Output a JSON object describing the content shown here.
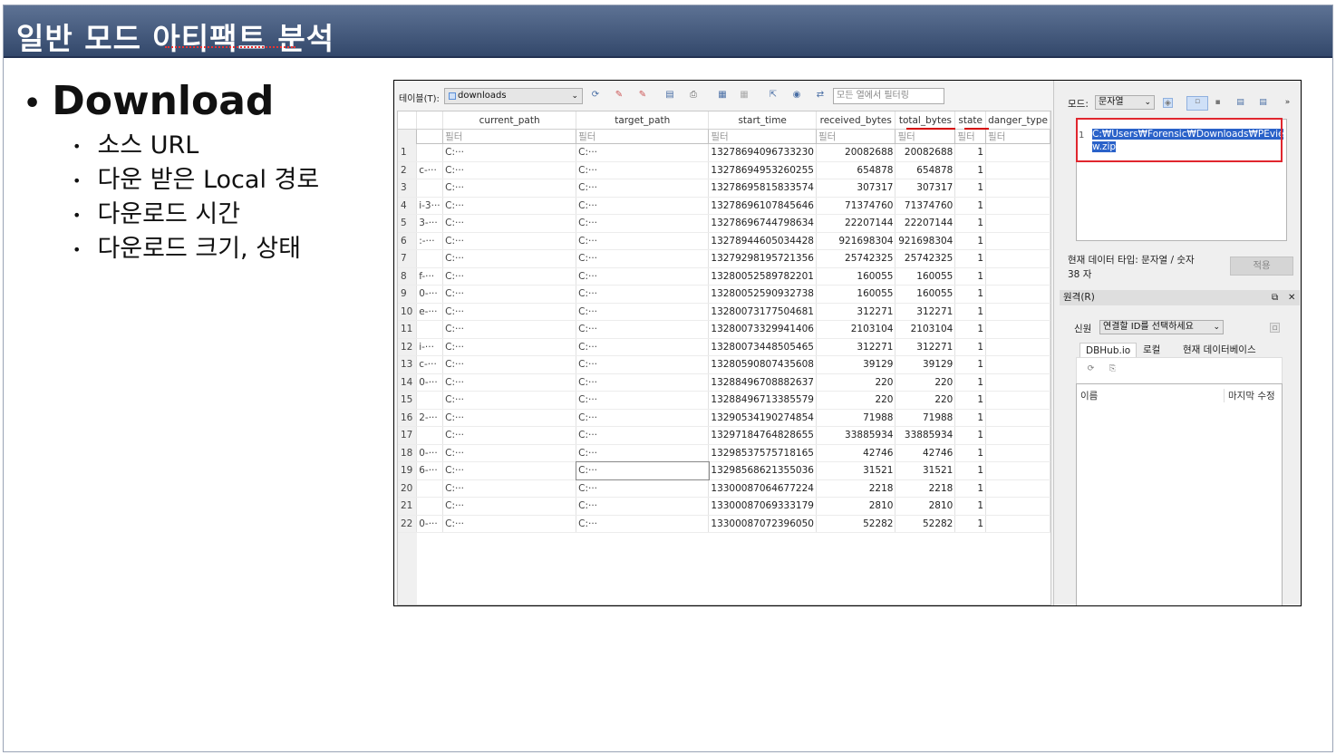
{
  "slide": {
    "title": "일반 모드 아티팩트 분석",
    "main_bullet": "Download",
    "sub_bullets": [
      "소스 URL",
      "다운 받은 Local 경로",
      "다운로드 시간",
      "다운로드 크기, 상태"
    ]
  },
  "toolbar": {
    "table_label": "테이블(T):",
    "table_value": "downloads",
    "filter_placeholder": "모든 열에서 필터링"
  },
  "grid": {
    "columns": [
      "current_path",
      "target_path",
      "start_time",
      "received_bytes",
      "total_bytes",
      "state",
      "danger_type"
    ],
    "filter_text": "필터",
    "rows": [
      {
        "n": "1",
        "pre": "",
        "cp": "C:···",
        "tp": "C:···",
        "st": "13278694096733230",
        "rb": "20082688",
        "tb": "20082688",
        "s": "1"
      },
      {
        "n": "2",
        "pre": "c-···",
        "cp": "C:···",
        "tp": "C:···",
        "st": "13278694953260255",
        "rb": "654878",
        "tb": "654878",
        "s": "1"
      },
      {
        "n": "3",
        "pre": "",
        "cp": "C:···",
        "tp": "C:···",
        "st": "13278695815833574",
        "rb": "307317",
        "tb": "307317",
        "s": "1"
      },
      {
        "n": "4",
        "pre": "i-3···",
        "cp": "C:···",
        "tp": "C:···",
        "st": "13278696107845646",
        "rb": "71374760",
        "tb": "71374760",
        "s": "1"
      },
      {
        "n": "5",
        "pre": "3-···",
        "cp": "C:···",
        "tp": "C:···",
        "st": "13278696744798634",
        "rb": "22207144",
        "tb": "22207144",
        "s": "1"
      },
      {
        "n": "6",
        "pre": ":-···",
        "cp": "C:···",
        "tp": "C:···",
        "st": "13278944605034428",
        "rb": "921698304",
        "tb": "921698304",
        "s": "1"
      },
      {
        "n": "7",
        "pre": "",
        "cp": "C:···",
        "tp": "C:···",
        "st": "13279298195721356",
        "rb": "25742325",
        "tb": "25742325",
        "s": "1"
      },
      {
        "n": "8",
        "pre": "f-···",
        "cp": "C:···",
        "tp": "C:···",
        "st": "13280052589782201",
        "rb": "160055",
        "tb": "160055",
        "s": "1"
      },
      {
        "n": "9",
        "pre": "0-···",
        "cp": "C:···",
        "tp": "C:···",
        "st": "13280052590932738",
        "rb": "160055",
        "tb": "160055",
        "s": "1"
      },
      {
        "n": "10",
        "pre": "e-···",
        "cp": "C:···",
        "tp": "C:···",
        "st": "13280073177504681",
        "rb": "312271",
        "tb": "312271",
        "s": "1"
      },
      {
        "n": "11",
        "pre": "",
        "cp": "C:···",
        "tp": "C:···",
        "st": "13280073329941406",
        "rb": "2103104",
        "tb": "2103104",
        "s": "1"
      },
      {
        "n": "12",
        "pre": "i-···",
        "cp": "C:···",
        "tp": "C:···",
        "st": "13280073448505465",
        "rb": "312271",
        "tb": "312271",
        "s": "1"
      },
      {
        "n": "13",
        "pre": "c-···",
        "cp": "C:···",
        "tp": "C:···",
        "st": "13280590807435608",
        "rb": "39129",
        "tb": "39129",
        "s": "1"
      },
      {
        "n": "14",
        "pre": "0-···",
        "cp": "C:···",
        "tp": "C:···",
        "st": "13288496708882637",
        "rb": "220",
        "tb": "220",
        "s": "1"
      },
      {
        "n": "15",
        "pre": "",
        "cp": "C:···",
        "tp": "C:···",
        "st": "13288496713385579",
        "rb": "220",
        "tb": "220",
        "s": "1"
      },
      {
        "n": "16",
        "pre": "2-···",
        "cp": "C:···",
        "tp": "C:···",
        "st": "13290534190274854",
        "rb": "71988",
        "tb": "71988",
        "s": "1"
      },
      {
        "n": "17",
        "pre": "",
        "cp": "C:···",
        "tp": "C:···",
        "st": "13297184764828655",
        "rb": "33885934",
        "tb": "33885934",
        "s": "1"
      },
      {
        "n": "18",
        "pre": "0-···",
        "cp": "C:···",
        "tp": "C:···",
        "st": "13298537575718165",
        "rb": "42746",
        "tb": "42746",
        "s": "1"
      },
      {
        "n": "19",
        "pre": "6-···",
        "cp": "C:···",
        "tp": "C:···",
        "st": "13298568621355036",
        "rb": "31521",
        "tb": "31521",
        "s": "1"
      },
      {
        "n": "20",
        "pre": "",
        "cp": "C:···",
        "tp": "C:···",
        "st": "13300087064677224",
        "rb": "2218",
        "tb": "2218",
        "s": "1"
      },
      {
        "n": "21",
        "pre": "",
        "cp": "C:···",
        "tp": "C:···",
        "st": "13300087069333179",
        "rb": "2810",
        "tb": "2810",
        "s": "1"
      },
      {
        "n": "22",
        "pre": "0-···",
        "cp": "C:···",
        "tp": "C:···",
        "st": "13300087072396050",
        "rb": "52282",
        "tb": "52282",
        "s": "1"
      }
    ]
  },
  "side": {
    "mode_label": "모드:",
    "mode_value": "문자열",
    "line_number": "1",
    "cell_value_line1": "C:₩Users₩Forensic₩Downloads₩PEvie",
    "cell_value_line2": "w.zip",
    "data_type": "현재 데이터 타입: 문자열 / 숫자",
    "char_count": "38 자",
    "apply_label": "적용",
    "remote_title": "원격(R)",
    "identity_label": "신원",
    "identity_value": "연결할 ID를 선택하세요",
    "tabs": [
      "DBHub.io",
      "로컬",
      "현재 데이터베이스"
    ],
    "list_name_header": "이름",
    "list_modified_header": "마지막 수정"
  },
  "colors": {
    "title_bar": "#3d5275",
    "highlight": "#2a62c9",
    "annotation_red": "#e0262e"
  }
}
